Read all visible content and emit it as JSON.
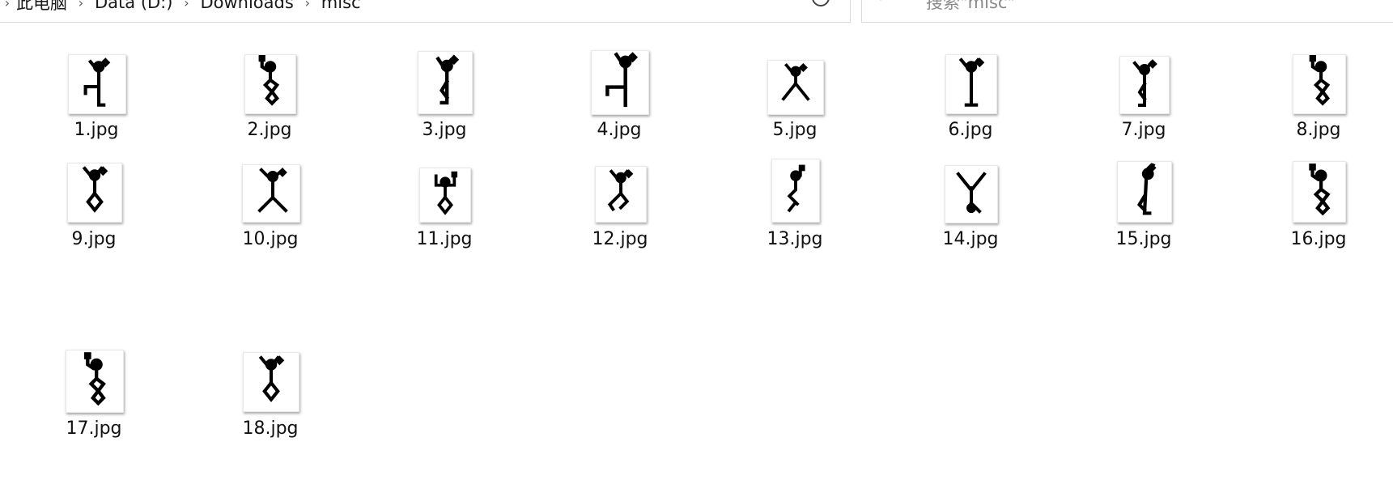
{
  "breadcrumb": {
    "segments": [
      "此电脑",
      "Data (D:)",
      "Downloads",
      "misc"
    ],
    "separator": "›"
  },
  "search": {
    "placeholder": "搜索\"misc\""
  },
  "files": [
    {
      "name": "1.jpg",
      "icon": "stick-figure-pose-1"
    },
    {
      "name": "2.jpg",
      "icon": "stick-figure-pose-2"
    },
    {
      "name": "3.jpg",
      "icon": "stick-figure-pose-3"
    },
    {
      "name": "4.jpg",
      "icon": "stick-figure-pose-4"
    },
    {
      "name": "5.jpg",
      "icon": "stick-figure-pose-5"
    },
    {
      "name": "6.jpg",
      "icon": "stick-figure-pose-6"
    },
    {
      "name": "7.jpg",
      "icon": "stick-figure-pose-7"
    },
    {
      "name": "8.jpg",
      "icon": "stick-figure-pose-8"
    },
    {
      "name": "9.jpg",
      "icon": "stick-figure-pose-9"
    },
    {
      "name": "10.jpg",
      "icon": "stick-figure-pose-10"
    },
    {
      "name": "11.jpg",
      "icon": "stick-figure-pose-11"
    },
    {
      "name": "12.jpg",
      "icon": "stick-figure-pose-12"
    },
    {
      "name": "13.jpg",
      "icon": "stick-figure-pose-13"
    },
    {
      "name": "14.jpg",
      "icon": "stick-figure-pose-14"
    },
    {
      "name": "15.jpg",
      "icon": "stick-figure-pose-15"
    },
    {
      "name": "16.jpg",
      "icon": "stick-figure-pose-16"
    },
    {
      "name": "17.jpg",
      "icon": "stick-figure-pose-17"
    },
    {
      "name": "18.jpg",
      "icon": "stick-figure-pose-18"
    }
  ]
}
